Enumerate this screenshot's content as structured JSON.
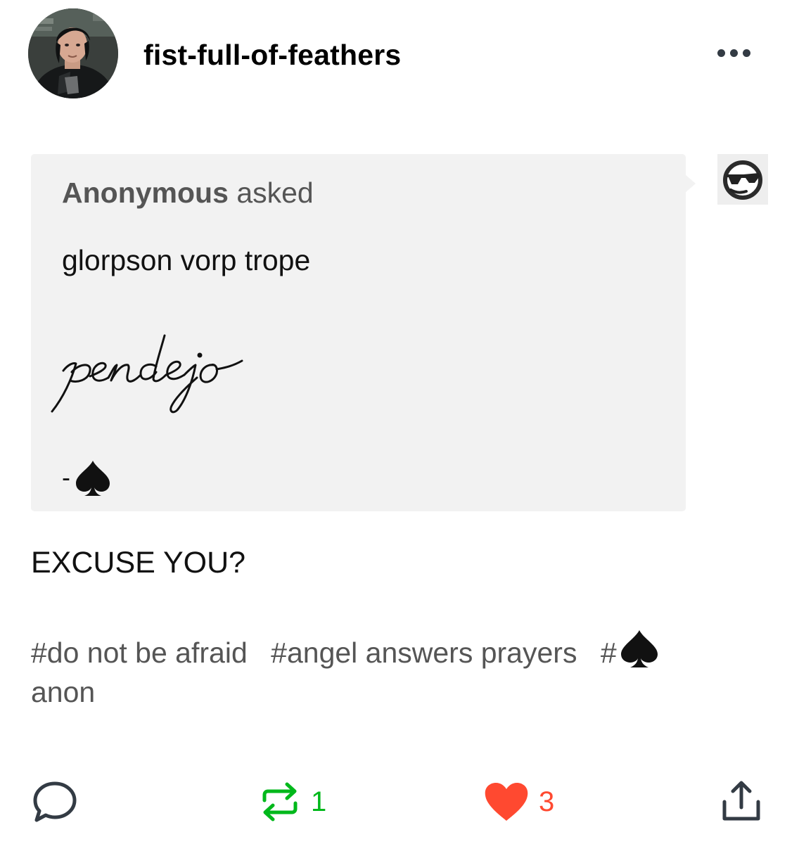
{
  "header": {
    "blog_name": "fist-full-of-feathers",
    "avatar_icon": "user-avatar-photo",
    "more_icon": "more-horizontal-icon"
  },
  "ask": {
    "asker_name": "Anonymous",
    "asked_label": "asked",
    "question": "glorpson vorp trope",
    "script_word": "pendejo",
    "signature_dash": "-",
    "signature_icon": "spade-emoji",
    "anon_icon": "sunglasses-face-icon"
  },
  "answer": {
    "text": "EXCUSE YOU?"
  },
  "tags": [
    "#do not be afraid",
    "#angel answers prayers"
  ],
  "spade_tag": {
    "prefix": "#",
    "suffix": "anon"
  },
  "actions": {
    "reply_icon": "speech-bubble-icon",
    "reblog_icon": "reblog-icon",
    "reblog_count": "1",
    "like_icon": "heart-icon",
    "like_count": "3",
    "share_icon": "share-icon",
    "reblog_color": "#00b81b",
    "like_color": "#ff4930"
  },
  "colors": {
    "ask_background": "#f2f2f2",
    "muted_text": "#555555",
    "text": "#000000"
  }
}
